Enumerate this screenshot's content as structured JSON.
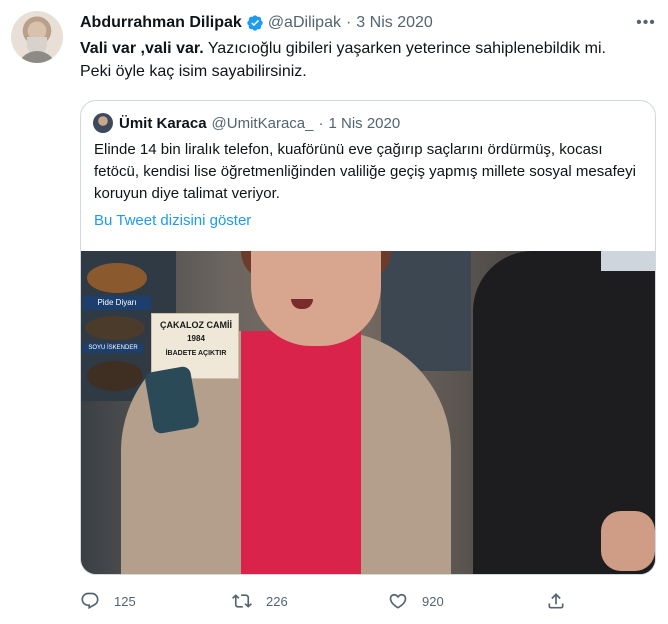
{
  "tweet": {
    "author_name": "Abdurrahman Dilipak",
    "handle": "@aDilipak",
    "separator": "·",
    "date": "3 Nis 2020",
    "more_label": "•••",
    "text_bold": "Vali var ,vali var.",
    "text_rest": " Yazıcıoğlu gibileri yaşarken yeterince sahiplenebildik mi.\nPeki öyle kaç isim sayabilirsiniz."
  },
  "quote": {
    "author_name": "Ümit Karaca",
    "handle": "@UmitKaraca_",
    "separator": "·",
    "date": "1 Nis 2020",
    "text": "Elinde 14 bin liralık telefon, kuaförünü eve çağırıp saçlarını ördürmüş, kocası fetöcü, kendisi lise öğretmenliğinden valiliğe geçiş yapmış millete sosyal mesafeyi koruyun diye talimat veriyor.",
    "show_thread": "Bu Tweet dizisini göster",
    "photo": {
      "sign_1": "Pide Diyarı",
      "sign_2": "SOYU İSKENDER",
      "poster_title": "ÇAKALOZ CAMİİ",
      "poster_year": "1984",
      "poster_line": "İBADETE AÇIKTIR"
    }
  },
  "actions": {
    "replies": "125",
    "retweets": "226",
    "likes": "920"
  },
  "icons": {
    "verified": "verified-badge-icon",
    "reply": "reply-icon",
    "retweet": "retweet-icon",
    "like": "heart-icon",
    "share": "share-icon"
  },
  "colors": {
    "accent": "#1d9bf0",
    "secondary_text": "#536471",
    "border": "#cfd9de"
  }
}
